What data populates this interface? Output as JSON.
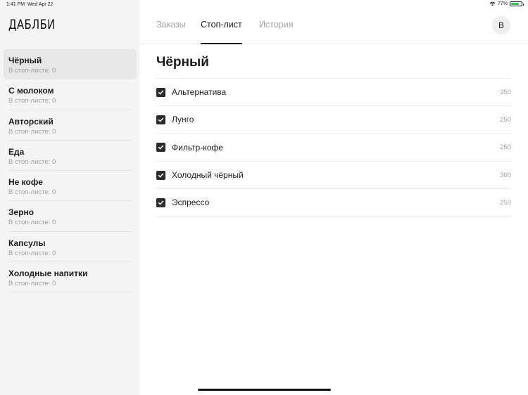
{
  "status_bar": {
    "time": "1:41 PM",
    "date": "Wed Apr 22",
    "battery": "77%",
    "battery_level": 0.77
  },
  "sidebar": {
    "logo": "ДАБЛБИ",
    "items": [
      {
        "name": "Чёрный",
        "sub": "В стоп-листе: 0",
        "active": true
      },
      {
        "name": "С молоком",
        "sub": "В стоп-листе: 0"
      },
      {
        "name": "Авторский",
        "sub": "В стоп-листе: 0"
      },
      {
        "name": "Еда",
        "sub": "В стоп-листе: 0"
      },
      {
        "name": "Не кофе",
        "sub": "В стоп-листе: 0"
      },
      {
        "name": "Зерно",
        "sub": "В стоп-листе: 0"
      },
      {
        "name": "Капсулы",
        "sub": "В стоп-листе: 0"
      },
      {
        "name": "Холодные напитки",
        "sub": "В стоп-листе: 0"
      }
    ]
  },
  "header": {
    "tabs": [
      {
        "label": "Заказы"
      },
      {
        "label": "Стоп-лист",
        "active": true
      },
      {
        "label": "История"
      }
    ],
    "avatar": "В"
  },
  "content": {
    "title": "Чёрный",
    "products": [
      {
        "name": "Альтернатива",
        "value": "250",
        "checked": true
      },
      {
        "name": "Лунго",
        "value": "250",
        "checked": true
      },
      {
        "name": "Фильтр-кофе",
        "value": "250",
        "checked": true
      },
      {
        "name": "Холодный чёрный",
        "value": "300",
        "checked": true
      },
      {
        "name": "Эспрессо",
        "value": "250",
        "checked": true
      }
    ]
  }
}
